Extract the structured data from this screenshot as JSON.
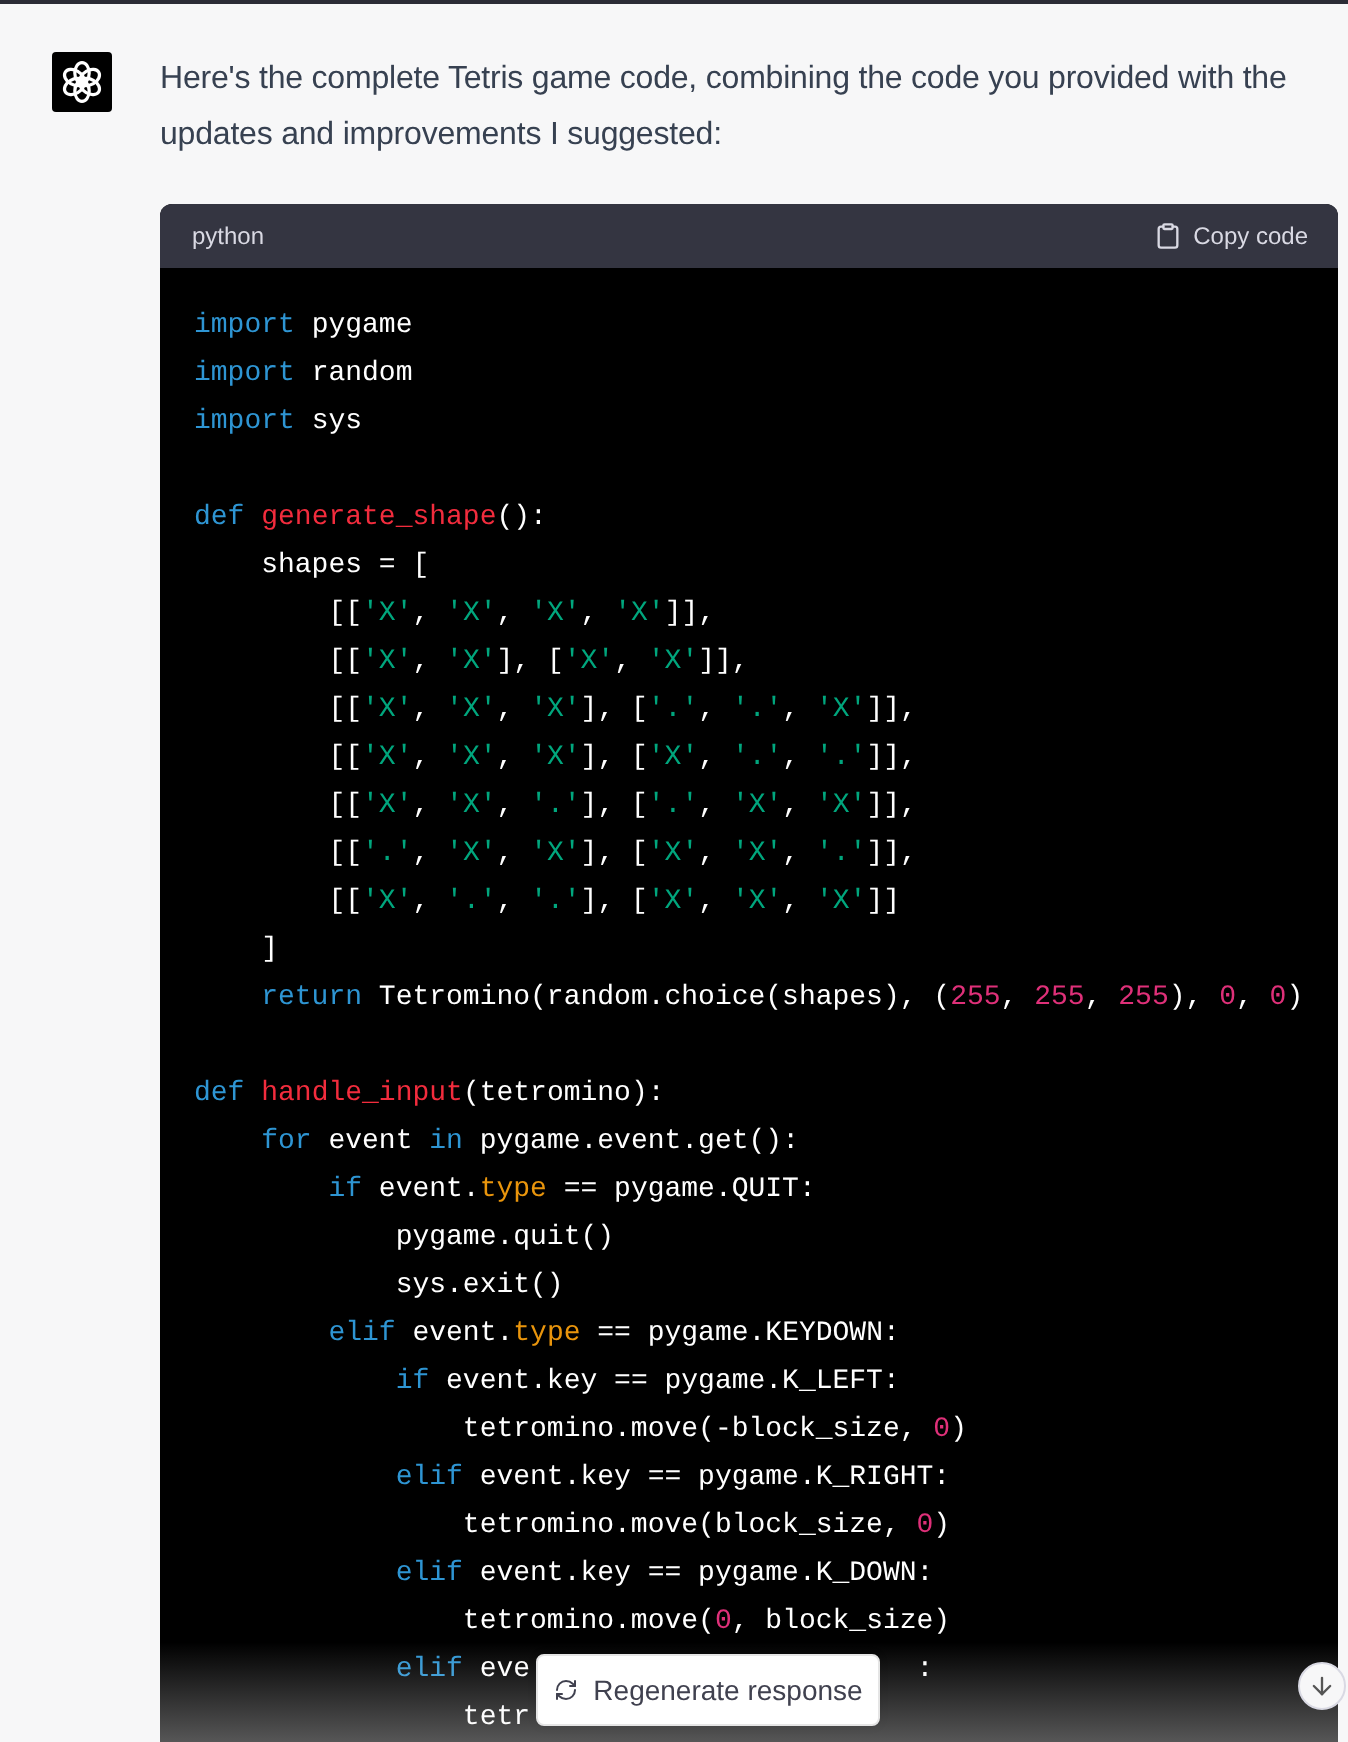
{
  "message": {
    "text": "Here's the complete Tetris game code, combining the code you provided with the updates and improvements I suggested:"
  },
  "code_block": {
    "language": "python",
    "copy_label": "Copy code",
    "lines": [
      {
        "tokens": [
          {
            "kind": "keyword",
            "text": "import"
          },
          {
            "kind": "plain",
            "text": " pygame"
          }
        ]
      },
      {
        "tokens": [
          {
            "kind": "keyword",
            "text": "import"
          },
          {
            "kind": "plain",
            "text": " random"
          }
        ]
      },
      {
        "tokens": [
          {
            "kind": "keyword",
            "text": "import"
          },
          {
            "kind": "plain",
            "text": " sys"
          }
        ]
      },
      {
        "kind": "blank"
      },
      {
        "tokens": [
          {
            "kind": "keyword",
            "text": "def "
          },
          {
            "kind": "function",
            "text": "generate_shape"
          },
          {
            "kind": "plain",
            "text": "():"
          }
        ]
      },
      {
        "tokens": [
          {
            "kind": "plain",
            "text": "    shapes = ["
          }
        ]
      },
      {
        "tokens": [
          {
            "kind": "plain",
            "text": "        [["
          },
          {
            "kind": "string",
            "text": "'X'"
          },
          {
            "kind": "plain",
            "text": ", "
          },
          {
            "kind": "string",
            "text": "'X'"
          },
          {
            "kind": "plain",
            "text": ", "
          },
          {
            "kind": "string",
            "text": "'X'"
          },
          {
            "kind": "plain",
            "text": ", "
          },
          {
            "kind": "string",
            "text": "'X'"
          },
          {
            "kind": "plain",
            "text": "]],"
          }
        ]
      },
      {
        "tokens": [
          {
            "kind": "plain",
            "text": "        [["
          },
          {
            "kind": "string",
            "text": "'X'"
          },
          {
            "kind": "plain",
            "text": ", "
          },
          {
            "kind": "string",
            "text": "'X'"
          },
          {
            "kind": "plain",
            "text": "], ["
          },
          {
            "kind": "string",
            "text": "'X'"
          },
          {
            "kind": "plain",
            "text": ", "
          },
          {
            "kind": "string",
            "text": "'X'"
          },
          {
            "kind": "plain",
            "text": "]],"
          }
        ]
      },
      {
        "tokens": [
          {
            "kind": "plain",
            "text": "        [["
          },
          {
            "kind": "string",
            "text": "'X'"
          },
          {
            "kind": "plain",
            "text": ", "
          },
          {
            "kind": "string",
            "text": "'X'"
          },
          {
            "kind": "plain",
            "text": ", "
          },
          {
            "kind": "string",
            "text": "'X'"
          },
          {
            "kind": "plain",
            "text": "], ["
          },
          {
            "kind": "string",
            "text": "'.'"
          },
          {
            "kind": "plain",
            "text": ", "
          },
          {
            "kind": "string",
            "text": "'.'"
          },
          {
            "kind": "plain",
            "text": ", "
          },
          {
            "kind": "string",
            "text": "'X'"
          },
          {
            "kind": "plain",
            "text": "]],"
          }
        ]
      },
      {
        "tokens": [
          {
            "kind": "plain",
            "text": "        [["
          },
          {
            "kind": "string",
            "text": "'X'"
          },
          {
            "kind": "plain",
            "text": ", "
          },
          {
            "kind": "string",
            "text": "'X'"
          },
          {
            "kind": "plain",
            "text": ", "
          },
          {
            "kind": "string",
            "text": "'X'"
          },
          {
            "kind": "plain",
            "text": "], ["
          },
          {
            "kind": "string",
            "text": "'X'"
          },
          {
            "kind": "plain",
            "text": ", "
          },
          {
            "kind": "string",
            "text": "'.'"
          },
          {
            "kind": "plain",
            "text": ", "
          },
          {
            "kind": "string",
            "text": "'.'"
          },
          {
            "kind": "plain",
            "text": "]],"
          }
        ]
      },
      {
        "tokens": [
          {
            "kind": "plain",
            "text": "        [["
          },
          {
            "kind": "string",
            "text": "'X'"
          },
          {
            "kind": "plain",
            "text": ", "
          },
          {
            "kind": "string",
            "text": "'X'"
          },
          {
            "kind": "plain",
            "text": ", "
          },
          {
            "kind": "string",
            "text": "'.'"
          },
          {
            "kind": "plain",
            "text": "], ["
          },
          {
            "kind": "string",
            "text": "'.'"
          },
          {
            "kind": "plain",
            "text": ", "
          },
          {
            "kind": "string",
            "text": "'X'"
          },
          {
            "kind": "plain",
            "text": ", "
          },
          {
            "kind": "string",
            "text": "'X'"
          },
          {
            "kind": "plain",
            "text": "]],"
          }
        ]
      },
      {
        "tokens": [
          {
            "kind": "plain",
            "text": "        [["
          },
          {
            "kind": "string",
            "text": "'.'"
          },
          {
            "kind": "plain",
            "text": ", "
          },
          {
            "kind": "string",
            "text": "'X'"
          },
          {
            "kind": "plain",
            "text": ", "
          },
          {
            "kind": "string",
            "text": "'X'"
          },
          {
            "kind": "plain",
            "text": "], ["
          },
          {
            "kind": "string",
            "text": "'X'"
          },
          {
            "kind": "plain",
            "text": ", "
          },
          {
            "kind": "string",
            "text": "'X'"
          },
          {
            "kind": "plain",
            "text": ", "
          },
          {
            "kind": "string",
            "text": "'.'"
          },
          {
            "kind": "plain",
            "text": "]],"
          }
        ]
      },
      {
        "tokens": [
          {
            "kind": "plain",
            "text": "        [["
          },
          {
            "kind": "string",
            "text": "'X'"
          },
          {
            "kind": "plain",
            "text": ", "
          },
          {
            "kind": "string",
            "text": "'.'"
          },
          {
            "kind": "plain",
            "text": ", "
          },
          {
            "kind": "string",
            "text": "'.'"
          },
          {
            "kind": "plain",
            "text": "], ["
          },
          {
            "kind": "string",
            "text": "'X'"
          },
          {
            "kind": "plain",
            "text": ", "
          },
          {
            "kind": "string",
            "text": "'X'"
          },
          {
            "kind": "plain",
            "text": ", "
          },
          {
            "kind": "string",
            "text": "'X'"
          },
          {
            "kind": "plain",
            "text": "]]"
          }
        ]
      },
      {
        "tokens": [
          {
            "kind": "plain",
            "text": "    ]"
          }
        ]
      },
      {
        "tokens": [
          {
            "kind": "keyword",
            "text": "    return"
          },
          {
            "kind": "plain",
            "text": " Tetromino(random.choice(shapes), ("
          },
          {
            "kind": "number",
            "text": "255"
          },
          {
            "kind": "plain",
            "text": ", "
          },
          {
            "kind": "number",
            "text": "255"
          },
          {
            "kind": "plain",
            "text": ", "
          },
          {
            "kind": "number",
            "text": "255"
          },
          {
            "kind": "plain",
            "text": "), "
          },
          {
            "kind": "number",
            "text": "0"
          },
          {
            "kind": "plain",
            "text": ", "
          },
          {
            "kind": "number",
            "text": "0"
          },
          {
            "kind": "plain",
            "text": ")"
          }
        ]
      },
      {
        "kind": "blank"
      },
      {
        "tokens": [
          {
            "kind": "keyword",
            "text": "def "
          },
          {
            "kind": "function",
            "text": "handle_input"
          },
          {
            "kind": "plain",
            "text": "(tetromino):"
          }
        ]
      },
      {
        "tokens": [
          {
            "kind": "keyword",
            "text": "    for"
          },
          {
            "kind": "plain",
            "text": " event "
          },
          {
            "kind": "keyword",
            "text": "in"
          },
          {
            "kind": "plain",
            "text": " pygame.event.get():"
          }
        ]
      },
      {
        "tokens": [
          {
            "kind": "keyword",
            "text": "        if"
          },
          {
            "kind": "plain",
            "text": " event."
          },
          {
            "kind": "attribute",
            "text": "type"
          },
          {
            "kind": "plain",
            "text": " == pygame.QUIT:"
          }
        ]
      },
      {
        "tokens": [
          {
            "kind": "plain",
            "text": "            pygame.quit()"
          }
        ]
      },
      {
        "tokens": [
          {
            "kind": "plain",
            "text": "            sys.exit()"
          }
        ]
      },
      {
        "tokens": [
          {
            "kind": "keyword",
            "text": "        elif"
          },
          {
            "kind": "plain",
            "text": " event."
          },
          {
            "kind": "attribute",
            "text": "type"
          },
          {
            "kind": "plain",
            "text": " == pygame.KEYDOWN:"
          }
        ]
      },
      {
        "tokens": [
          {
            "kind": "keyword",
            "text": "            if"
          },
          {
            "kind": "plain",
            "text": " event.key == pygame.K_LEFT:"
          }
        ]
      },
      {
        "tokens": [
          {
            "kind": "plain",
            "text": "                tetromino.move(-block_size, "
          },
          {
            "kind": "number",
            "text": "0"
          },
          {
            "kind": "plain",
            "text": ")"
          }
        ]
      },
      {
        "tokens": [
          {
            "kind": "keyword",
            "text": "            elif"
          },
          {
            "kind": "plain",
            "text": " event.key == pygame.K_RIGHT:"
          }
        ]
      },
      {
        "tokens": [
          {
            "kind": "plain",
            "text": "                tetromino.move(block_size, "
          },
          {
            "kind": "number",
            "text": "0"
          },
          {
            "kind": "plain",
            "text": ")"
          }
        ]
      },
      {
        "tokens": [
          {
            "kind": "keyword",
            "text": "            elif"
          },
          {
            "kind": "plain",
            "text": " event.key == pygame.K_DOWN:"
          }
        ]
      },
      {
        "tokens": [
          {
            "kind": "plain",
            "text": "                tetromino.move("
          },
          {
            "kind": "number",
            "text": "0"
          },
          {
            "kind": "plain",
            "text": ", block_size)"
          }
        ]
      },
      {
        "tokens": [
          {
            "kind": "keyword",
            "text": "            elif"
          },
          {
            "kind": "plain",
            "text": " eve"
          },
          {
            "kind": "covered"
          },
          {
            "kind": "plain",
            "text": ":"
          }
        ]
      },
      {
        "tokens": [
          {
            "kind": "plain",
            "text": "                tetr"
          }
        ]
      }
    ]
  },
  "regenerate_button": {
    "label": "Regenerate response"
  }
}
